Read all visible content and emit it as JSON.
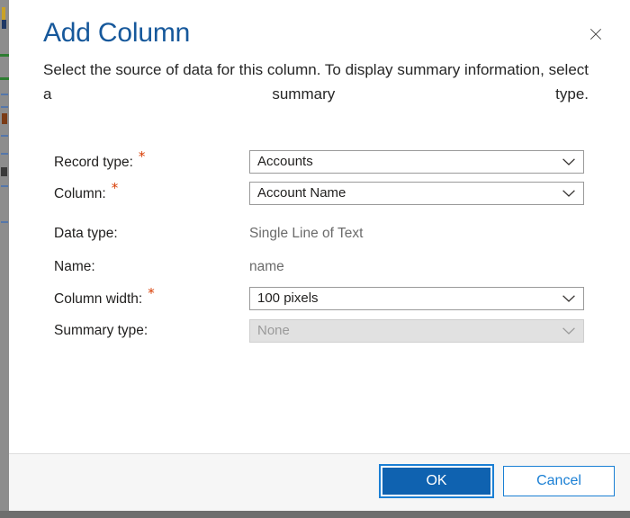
{
  "dialog": {
    "title": "Add Column",
    "description": "Select the source of data for this column. To display summary information, select a summary type.",
    "close_icon": "close-icon",
    "accent_color": "#16589b",
    "required_marker": "*",
    "required_color": "#d83b01"
  },
  "form": {
    "rows": [
      {
        "label": "Record type:",
        "required": true,
        "control": "combobox",
        "value": "Accounts",
        "disabled": false
      },
      {
        "label": "Column:",
        "required": true,
        "control": "combobox",
        "value": "Account Name",
        "disabled": false
      },
      {
        "label": "Data type:",
        "required": false,
        "control": "static",
        "value": "Single Line of Text",
        "disabled": false
      },
      {
        "label": "Name:",
        "required": false,
        "control": "static",
        "value": "name",
        "disabled": false
      },
      {
        "label": "Column width:",
        "required": true,
        "control": "combobox",
        "value": "100 pixels",
        "disabled": false
      },
      {
        "label": "Summary type:",
        "required": false,
        "control": "combobox",
        "value": "None",
        "disabled": true
      }
    ]
  },
  "footer": {
    "ok_label": "OK",
    "cancel_label": "Cancel",
    "ok_color": "#0f62b0",
    "cancel_color": "#1a7fd4"
  }
}
